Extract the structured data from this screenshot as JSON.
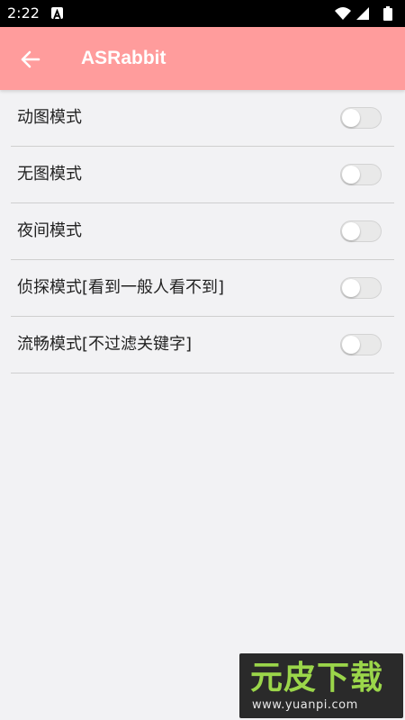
{
  "status_bar": {
    "time": "2:22",
    "icons": [
      "notification-a-icon",
      "wifi-icon",
      "signal-icon",
      "battery-icon"
    ]
  },
  "app_bar": {
    "back_icon": "arrow-left-icon",
    "title": "ASRabbit",
    "background_color": "#ff9c9c"
  },
  "settings": {
    "items": [
      {
        "label": "动图模式",
        "enabled": false
      },
      {
        "label": "无图模式",
        "enabled": false
      },
      {
        "label": "夜间模式",
        "enabled": false
      },
      {
        "label": "侦探模式[看到一般人看不到]",
        "enabled": false
      },
      {
        "label": "流畅模式[不过滤关键字]",
        "enabled": false
      }
    ]
  },
  "watermark": {
    "logo_text": "元皮下载",
    "url": "www.yuanpi.com"
  }
}
